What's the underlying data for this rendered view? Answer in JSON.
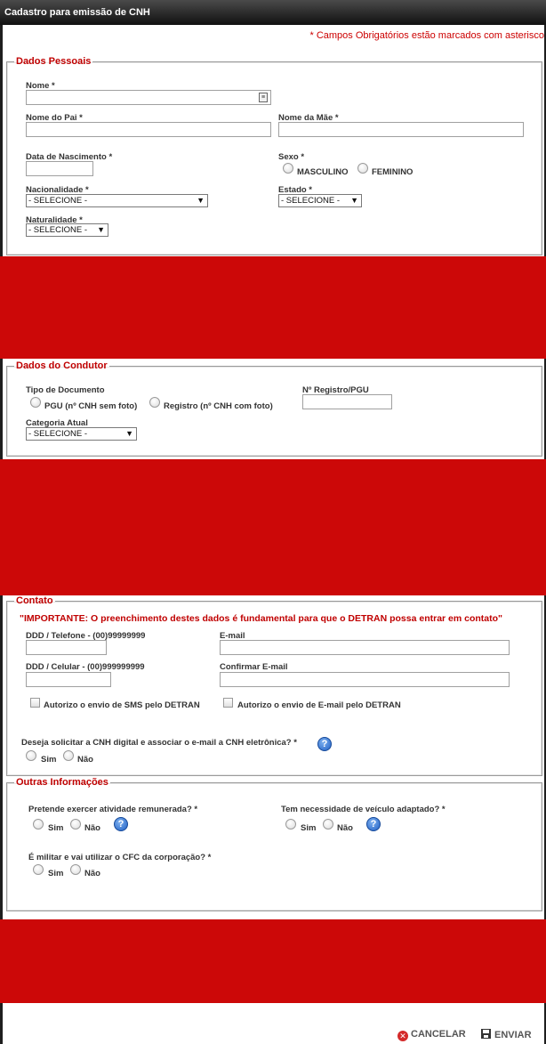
{
  "window": {
    "title": "Cadastro para emissão de CNH"
  },
  "required_note": "* Campos Obrigatórios estão marcados com asterisco",
  "dados_pessoais": {
    "legend": "Dados Pessoais",
    "nome_label": "Nome *",
    "nome_pai_label": "Nome do Pai *",
    "nome_mae_label": "Nome da Mãe *",
    "data_nasc_label": "Data de Nascimento *",
    "sexo_label": "Sexo *",
    "masculino": "MASCULINO",
    "feminino": "FEMININO",
    "nacionalidade_label": "Nacionalidade *",
    "nacionalidade_value": "- SELECIONE -",
    "estado_label": "Estado *",
    "estado_value": "- SELECIONE -",
    "naturalidade_label": "Naturalidade *",
    "naturalidade_value": "- SELECIONE -"
  },
  "dados_condutor": {
    "legend": "Dados do Condutor",
    "tipo_doc_label": "Tipo de Documento",
    "pgu_option": "PGU (nº CNH sem foto)",
    "registro_option": "Registro (nº CNH com foto)",
    "registro_pgu_label": "Nº Registro/PGU",
    "categoria_label": "Categoria Atual",
    "categoria_value": "- SELECIONE -"
  },
  "contato": {
    "legend": "Contato",
    "important": "\"IMPORTANTE: O preenchimento destes dados é fundamental para que o DETRAN possa entrar em contato\"",
    "telefone_label": "DDD / Telefone - (00)99999999",
    "email_label": "E-mail",
    "celular_label": "DDD / Celular - (00)999999999",
    "confirmar_email_label": "Confirmar E-mail",
    "sms_label": "Autorizo o envio de SMS pelo DETRAN",
    "email_auth_label": "Autorizo o envio de E-mail pelo DETRAN",
    "cnh_digital_label": "Deseja solicitar a CNH digital e associar o e-mail a CNH eletrônica? *",
    "sim": "Sim",
    "nao": "Não"
  },
  "outras": {
    "legend": "Outras Informações",
    "atividade_label": "Pretende exercer atividade remunerada? *",
    "veiculo_label": "Tem necessidade de veículo adaptado? *",
    "militar_label": "É militar e vai utilizar o CFC da corporação? *",
    "sim": "Sim",
    "nao": "Não"
  },
  "footer": {
    "cancel": "CANCELAR",
    "send": "ENVIAR"
  },
  "colors": {
    "accent": "#c00000",
    "redaction": "#cc0808",
    "help": "#1f5fc4"
  }
}
